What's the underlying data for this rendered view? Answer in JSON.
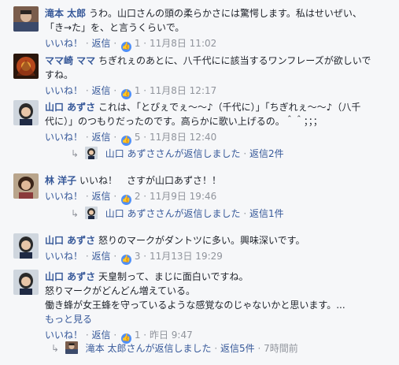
{
  "comments": [
    {
      "author": "滝本 太郎",
      "line1": "うわ。山口さんの頭の柔らかさには驚愕します。私はせいぜい、",
      "line2": "「き→た」を、と言うくらいで。",
      "like_label": "いいね！",
      "reply_label": "返信",
      "like_count": "1",
      "time": "11月8日 11:02"
    },
    {
      "author": "ママ崎 ママ",
      "line1": "ちぎれぇのあとに、八千代にに該当するワンフレーズが欲しいで",
      "line2": "すね。",
      "like_label": "いいね！",
      "reply_label": "返信",
      "like_count": "1",
      "time": "11月8日 12:17"
    },
    {
      "author": "山口 あずさ",
      "line1": "これは、「とぴぇでぇ〜〜♪（千代に）」「ちぎれぇ〜〜♪（八千",
      "line2": "代に）」のつもりだったのです。高らかに歌い上げるの。＾＾；；；",
      "like_label": "いいね！",
      "reply_label": "返信",
      "like_count": "5",
      "time": "11月8日 12:40",
      "reply_summary": "山口 あずささんが返信しました",
      "reply_count": "返信2件"
    },
    {
      "author": "林 洋子",
      "line1": "いいね！　さすが山口あずさ！！",
      "like_label": "いいね！",
      "reply_label": "返信",
      "like_count": "2",
      "time": "11月9日 19:46",
      "reply_summary": "山口 あずささんが返信しました",
      "reply_count": "返信1件"
    },
    {
      "author": "山口 あずさ",
      "line1": "怒りのマークがダントツに多い。興味深いです。",
      "like_label": "いいね！",
      "reply_label": "返信",
      "like_count": "3",
      "time": "11月13日 19:29"
    },
    {
      "author": "山口 あずさ",
      "line1": "天皇制って、まじに面白いですね。",
      "line2": "怒りマークがどんどん増えている。",
      "line3": "働き蜂が女王蜂を守っているような感覚なのじゃないかと思います。...",
      "more": "もっと見る",
      "like_label": "いいね！",
      "reply_label": "返信",
      "like_count": "1",
      "time": "昨日 9:47",
      "reply_summary": "滝本 太郎さんが返信しました",
      "reply_count": "返信5件",
      "reply_time": "7時間前"
    }
  ],
  "separator": "·",
  "reply_arrow": "↳",
  "colors": {
    "link": "#365899",
    "meta": "#90949c",
    "like": "#4f8ff7",
    "bg": "#f6f7f9"
  }
}
